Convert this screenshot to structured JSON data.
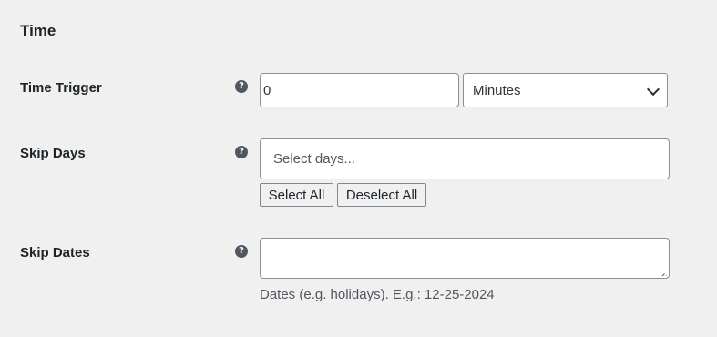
{
  "section": {
    "title": "Time"
  },
  "time_trigger": {
    "label": "Time Trigger",
    "help_icon": "question-icon",
    "value": "0",
    "unit_select": {
      "selected": "Minutes",
      "icon": "chevron-down-icon"
    }
  },
  "skip_days": {
    "label": "Skip Days",
    "help_icon": "question-icon",
    "placeholder": "Select days...",
    "select_all_label": "Select All",
    "deselect_all_label": "Deselect All"
  },
  "skip_dates": {
    "label": "Skip Dates",
    "help_icon": "question-icon",
    "value": "",
    "description": "Dates (e.g. holidays). E.g.: 12-25-2024"
  },
  "help_glyph": "?"
}
